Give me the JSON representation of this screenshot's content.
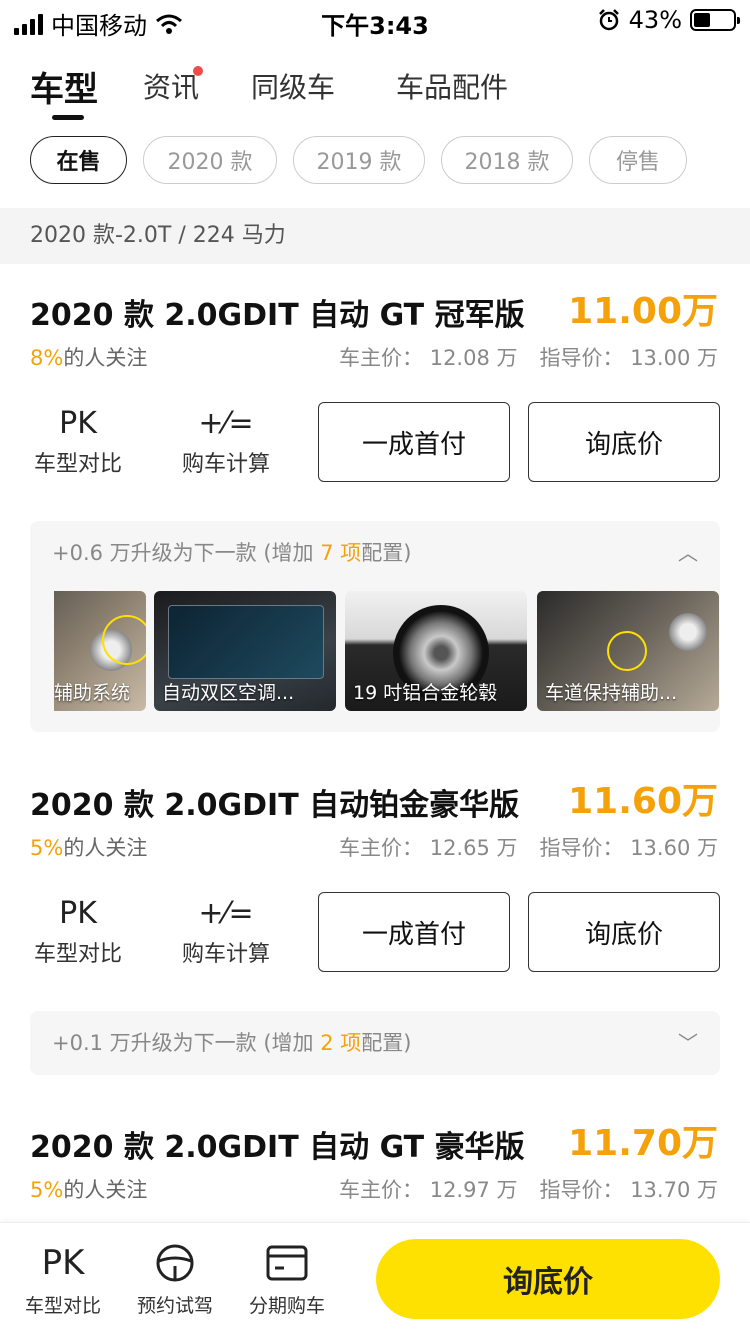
{
  "status_bar": {
    "carrier": "中国移动",
    "time": "下午3:43",
    "battery": "43%",
    "battery_level": 0.43
  },
  "tabs": [
    {
      "label": "车型",
      "active": true
    },
    {
      "label": "资讯",
      "badge": true
    },
    {
      "label": "同级车"
    },
    {
      "label": "车品配件"
    }
  ],
  "chips": [
    "在售",
    "2020 款",
    "2019 款",
    "2018 款",
    "停售"
  ],
  "section": {
    "title": "2020 款-2.0T / 224 马力"
  },
  "cars": [
    {
      "title": "2020 款 2.0GDIT 自动 GT 冠军版",
      "price": "11.00万",
      "attention_pct": "8%",
      "attention_text": "的人关注",
      "owner_price": "车主价： 12.08 万",
      "guide_price": "指导价： 13.00 万",
      "upgrade": {
        "prefix": "+0.6 万升级为下一款 (增加 ",
        "count": "7 项",
        "suffix": "配置)",
        "chevron": "︿",
        "features": [
          "辅助系统",
          "自动双区空调...",
          "19 吋铝合金轮毂",
          "车道保持辅助..."
        ]
      }
    },
    {
      "title": "2020 款 2.0GDIT 自动铂金豪华版",
      "price": "11.60万",
      "attention_pct": "5%",
      "attention_text": "的人关注",
      "owner_price": "车主价： 12.65 万",
      "guide_price": "指导价： 13.60 万",
      "upgrade": {
        "prefix": "+0.1 万升级为下一款 (增加 ",
        "count": "2 项",
        "suffix": "配置)",
        "chevron": "﹀"
      }
    },
    {
      "title": "2020 款 2.0GDIT 自动 GT 豪华版",
      "price": "11.70万",
      "attention_pct": "5%",
      "attention_text": "的人关注",
      "owner_price": "车主价： 12.97 万",
      "guide_price": "指导价： 13.70 万"
    }
  ],
  "actions": {
    "pk_glyph": "PK",
    "pk_label": "车型对比",
    "calc_glyph": "+⁄=",
    "calc_label": "购车计算",
    "down_payment": "一成首付",
    "inquiry": "询底价"
  },
  "bottom": {
    "pk_glyph": "PK",
    "pk_label": "车型对比",
    "test_drive": "预约试驾",
    "installment": "分期购车",
    "main_button": "询底价"
  },
  "colors": {
    "accent": "#f5a20a",
    "cta": "#ffe100",
    "badge": "#ef4b4b"
  }
}
